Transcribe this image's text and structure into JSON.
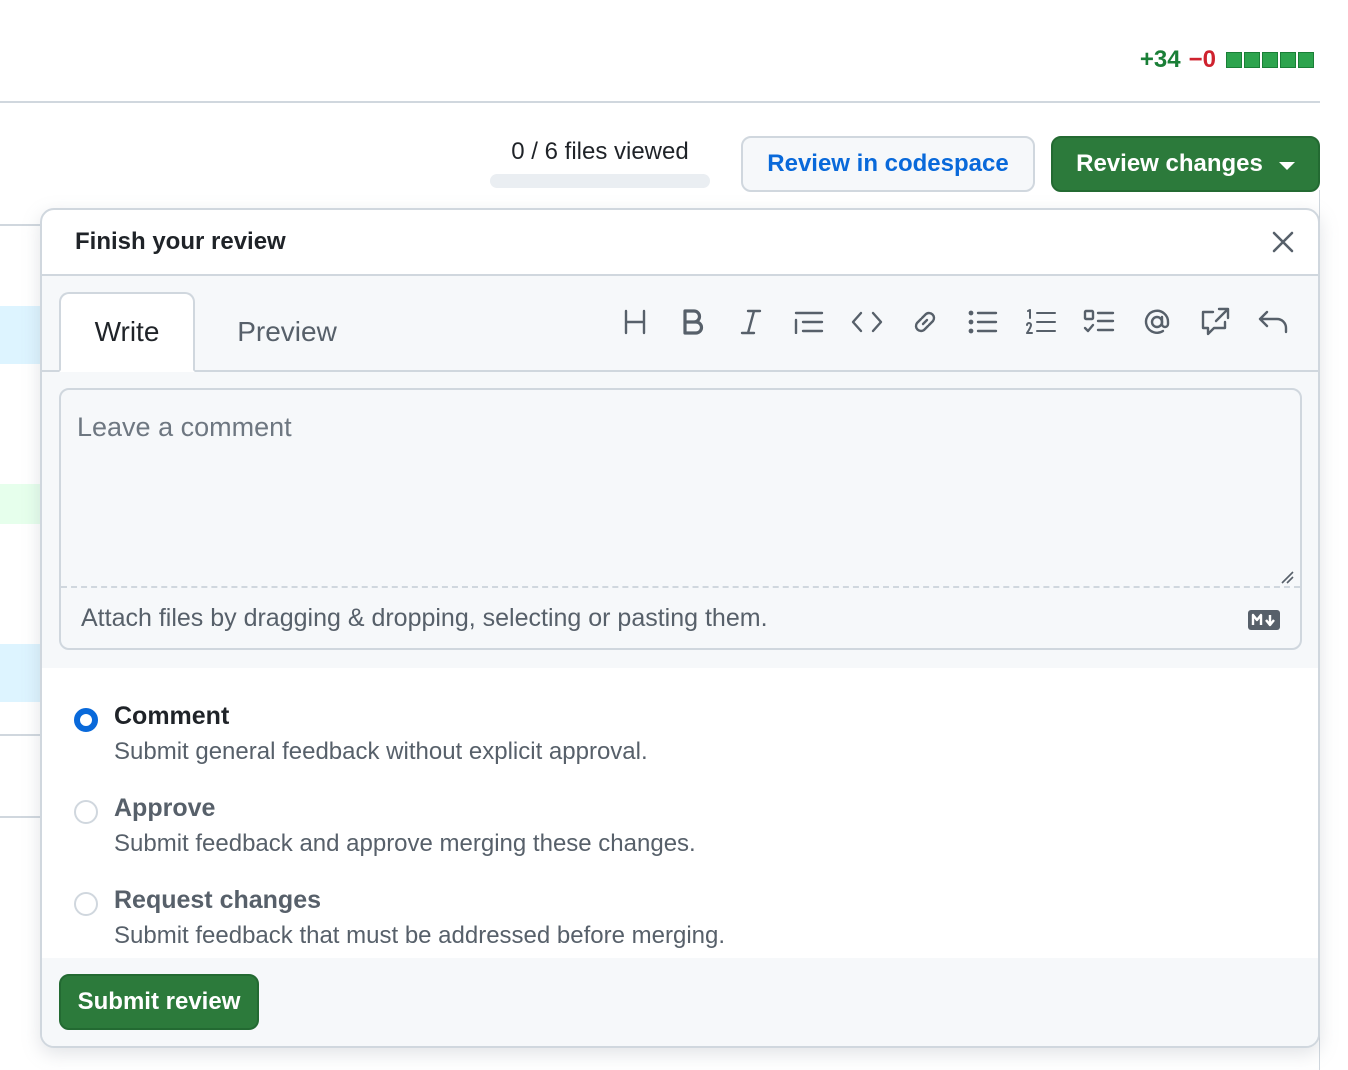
{
  "diffstat": {
    "additions": "+34",
    "deletions": "−0",
    "blocks": 5
  },
  "toolbar": {
    "files_viewed": "0 / 6 files viewed",
    "review_in_codespace": "Review in codespace",
    "review_changes": "Review changes"
  },
  "review": {
    "title": "Finish your review",
    "tabs": {
      "write": "Write",
      "preview": "Preview"
    },
    "comment_placeholder": "Leave a comment",
    "attach_hint": "Attach files by dragging & dropping, selecting or pasting them.",
    "markdown_icon": "markdown-icon",
    "options": [
      {
        "label": "Comment",
        "desc": "Submit general feedback without explicit approval.",
        "checked": true
      },
      {
        "label": "Approve",
        "desc": "Submit feedback and approve merging these changes.",
        "checked": false
      },
      {
        "label": "Request changes",
        "desc": "Submit feedback that must be addressed before merging.",
        "checked": false
      }
    ],
    "submit": "Submit review"
  },
  "toolbar_icons": [
    "heading-icon",
    "bold-icon",
    "italic-icon",
    "quote-icon",
    "code-icon",
    "link-icon",
    "unordered-list-icon",
    "ordered-list-icon",
    "task-list-icon",
    "mention-icon",
    "reference-icon",
    "reply-icon"
  ],
  "colors": {
    "accent": "#0969da",
    "primary_button": "#2c7a3b",
    "additions": "#1a7f37",
    "deletions": "#cf222e"
  }
}
